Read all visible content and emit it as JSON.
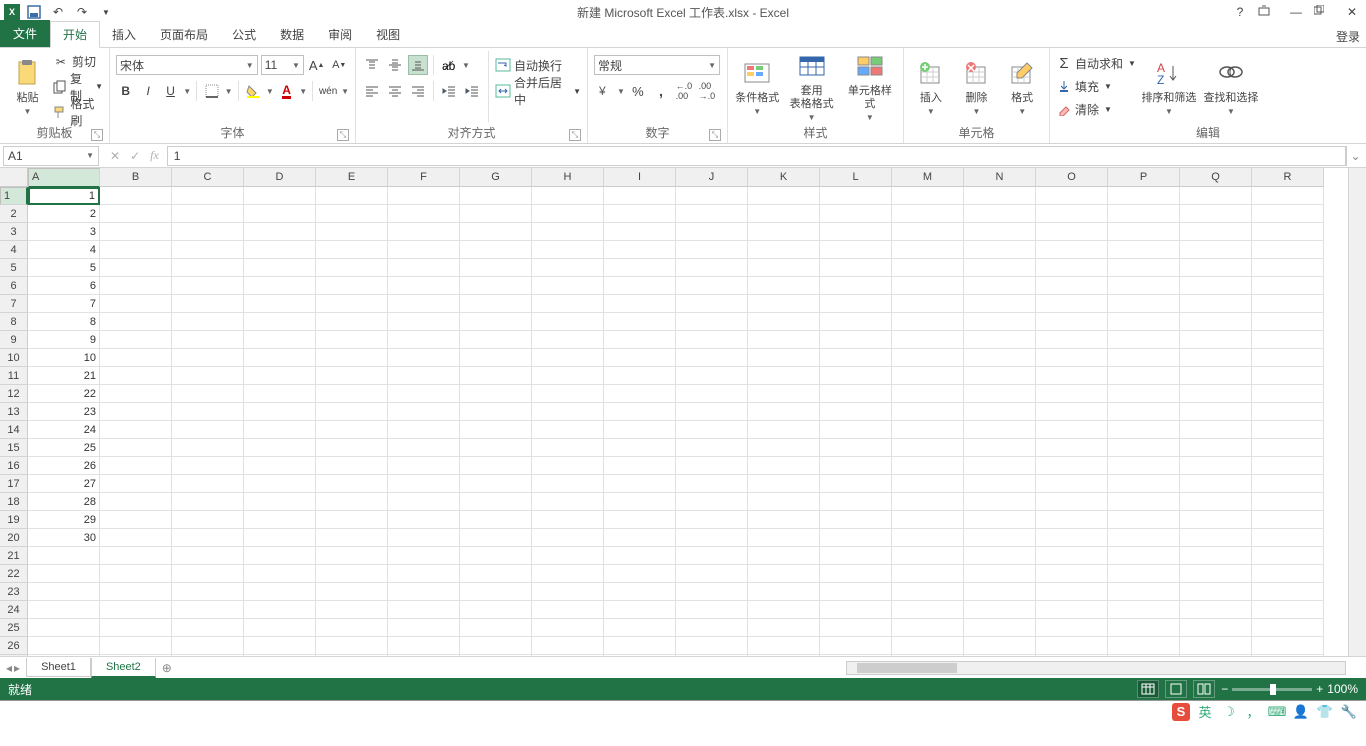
{
  "title": "新建 Microsoft Excel 工作表.xlsx - Excel",
  "login": "登录",
  "tabs": [
    "文件",
    "开始",
    "插入",
    "页面布局",
    "公式",
    "数据",
    "审阅",
    "视图"
  ],
  "active_tab": 1,
  "qat": {
    "undo": "↶",
    "redo": "↷"
  },
  "ribbon": {
    "clipboard": {
      "label": "剪贴板",
      "paste": "粘贴",
      "cut": "剪切",
      "copy": "复制",
      "painter": "格式刷"
    },
    "font": {
      "label": "字体",
      "name": "宋体",
      "size": "11",
      "bold": "B",
      "italic": "I",
      "underline": "U",
      "phonetic": "wén"
    },
    "align": {
      "label": "对齐方式",
      "wrap": "自动换行",
      "merge": "合并后居中"
    },
    "number": {
      "label": "数字",
      "format": "常规",
      "percent": "%",
      "comma": ",",
      "dec_inc": ".0",
      "dec_dec": ".00"
    },
    "styles": {
      "label": "样式",
      "cond": "条件格式",
      "table": "套用\n表格格式",
      "cell": "单元格样式"
    },
    "cells": {
      "label": "单元格",
      "insert": "插入",
      "delete": "删除",
      "format": "格式"
    },
    "editing": {
      "label": "编辑",
      "sum": "自动求和",
      "fill": "填充",
      "clear": "清除",
      "sort": "排序和筛选",
      "find": "查找和选择"
    }
  },
  "namebox": "A1",
  "formula": "1",
  "columns": [
    "A",
    "B",
    "C",
    "D",
    "E",
    "F",
    "G",
    "H",
    "I",
    "J",
    "K",
    "L",
    "M",
    "N",
    "O",
    "P",
    "Q",
    "R"
  ],
  "row_count": 27,
  "selected_col": 0,
  "selected_row": 0,
  "cell_data": {
    "A": [
      "1",
      "2",
      "3",
      "4",
      "5",
      "6",
      "7",
      "8",
      "9",
      "10",
      "21",
      "22",
      "23",
      "24",
      "25",
      "26",
      "27",
      "28",
      "29",
      "30"
    ]
  },
  "sheets": [
    "Sheet1",
    "Sheet2"
  ],
  "active_sheet": 1,
  "status": {
    "ready": "就绪",
    "zoom": "100%"
  },
  "tray": {
    "ime": "英"
  }
}
